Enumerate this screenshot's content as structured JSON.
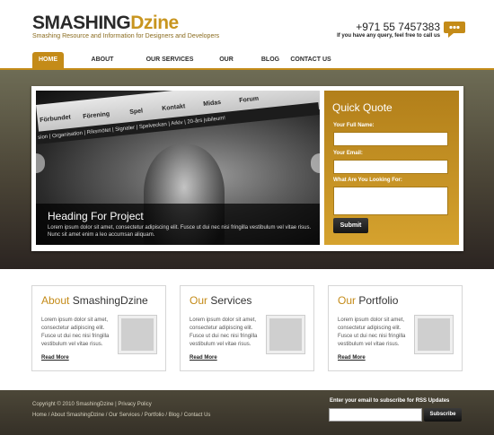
{
  "header": {
    "logo_part1": "SMASHING",
    "logo_part2": "Dzine",
    "tagline": "Smashing Resource and Information for Designers and Developers",
    "phone": "+971 55 7457383",
    "phone_note": "If you have any query, feel free to call us"
  },
  "nav": {
    "items": [
      {
        "label": "HOME",
        "active": true
      },
      {
        "label": "ABOUT SMASHINGDZINE"
      },
      {
        "label": "OUR SERVICES"
      },
      {
        "label": "OUR PORTFOLIO"
      },
      {
        "label": "BLOG"
      },
      {
        "label": "CONTACT US"
      }
    ]
  },
  "slider": {
    "menu": [
      "Förbundet",
      "Förening",
      "Spel",
      "Kontakt",
      "Midas",
      "Forum"
    ],
    "submenu": "sion | Organisation | Riksmötet | Signaler | Spelveckan | Arkiv | 20-års jubileum!",
    "heading": "Heading For Project",
    "text": "Lorem ipsum dolor sit amet, consectetur adipiscing elit. Fusce ut dui nec nisi fringilla vestibulum vel vitae risus. Nunc sit amet enim a leo accumsan aliquam."
  },
  "quote": {
    "title": "Quick Quote",
    "name_label": "Your Full Name:",
    "email_label": "Your Email:",
    "looking_label": "What Are You Looking For:",
    "submit_label": "Submit"
  },
  "boxes": [
    {
      "title_accent": "About",
      "title_rest": " SmashingDzine",
      "text": "Lorem ipsum dolor sit amet, consectetur adipiscing elit. Fusce ut dui nec nisi fringilla vestibulum vel vitae risus.",
      "more": "Read More"
    },
    {
      "title_accent": "Our",
      "title_rest": " Services",
      "text": "Lorem ipsum dolor sit amet, consectetur adipiscing elit. Fusce ut dui nec nisi fringilla vestibulum vel vitae risus.",
      "more": "Read More"
    },
    {
      "title_accent": "Our",
      "title_rest": " Portfolio",
      "text": "Lorem ipsum dolor sit amet, consectetur adipiscing elit. Fusce ut dui nec nisi fringilla vestibulum vel vitae risus.",
      "more": "Read More"
    }
  ],
  "footer": {
    "copyright": "Copyright © 2010 SmashingDzine | Privacy Policy",
    "links": "Home / About SmashingDzine / Our Services / Portfolio / Blog / Contact Us",
    "rss_label": "Enter your email to subscribe for RSS Updates",
    "subscribe_label": "Subscribe"
  },
  "colors": {
    "accent": "#c48b18",
    "dark": "#2b2421"
  },
  "icons": {
    "contact": "chat-bubble-icon"
  }
}
